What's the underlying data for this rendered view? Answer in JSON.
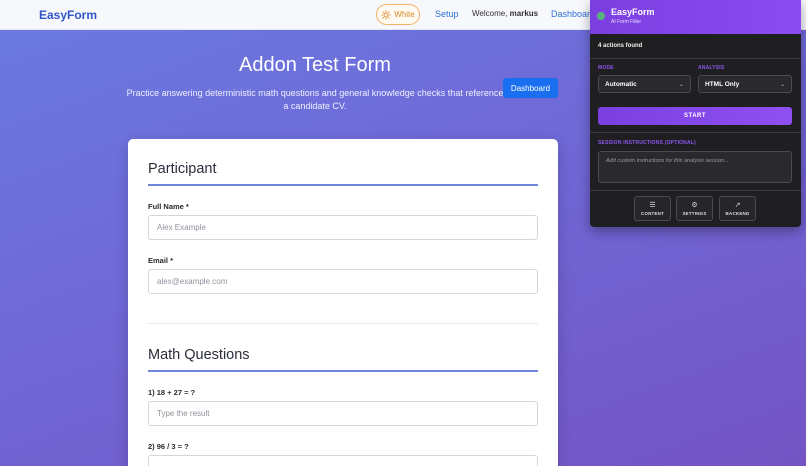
{
  "nav": {
    "brand": "EasyForm",
    "theme_label": "White",
    "setup": "Setup",
    "welcome_prefix": "Welcome,",
    "username": "markus",
    "dashboard": "Dashboard"
  },
  "hero": {
    "title": "Addon Test Form",
    "subtitle": "Practice answering deterministic math questions and general knowledge checks that reference a candidate CV.",
    "dashboard_button": "Dashboard"
  },
  "form": {
    "participant": {
      "title": "Participant",
      "full_name_label": "Full Name *",
      "full_name_placeholder": "Alex Example",
      "email_label": "Email *",
      "email_placeholder": "alex@example.com"
    },
    "math": {
      "title": "Math Questions",
      "q1_label": "1) 18 + 27 = ?",
      "q1_placeholder": "Type the result",
      "q2_label": "2) 96 / 3 = ?"
    }
  },
  "extension": {
    "title": "EasyForm",
    "subtitle": "AI Form Filler",
    "actions_found": "4 actions found",
    "mode_label": "MODE",
    "mode_value": "Automatic",
    "analysis_label": "ANALYSIS",
    "analysis_value": "HTML Only",
    "start": "START",
    "instructions_label": "SESSION INSTRUCTIONS (OPTIONAL)",
    "instructions_placeholder": "Add custom instructions for this analysis session...",
    "tools": {
      "content": "CONTENT",
      "settings": "SETTINGS",
      "backend": "BACKEND"
    }
  },
  "colors": {
    "brand": "#2f56c8",
    "accent_purple": "#8c4cf0",
    "primary_button": "#1a6ff0",
    "status_green": "#58b47d"
  },
  "icons": [
    "sun-icon",
    "hamburger-icon",
    "gear-icon",
    "external-link-icon",
    "chevron-down-icon"
  ]
}
